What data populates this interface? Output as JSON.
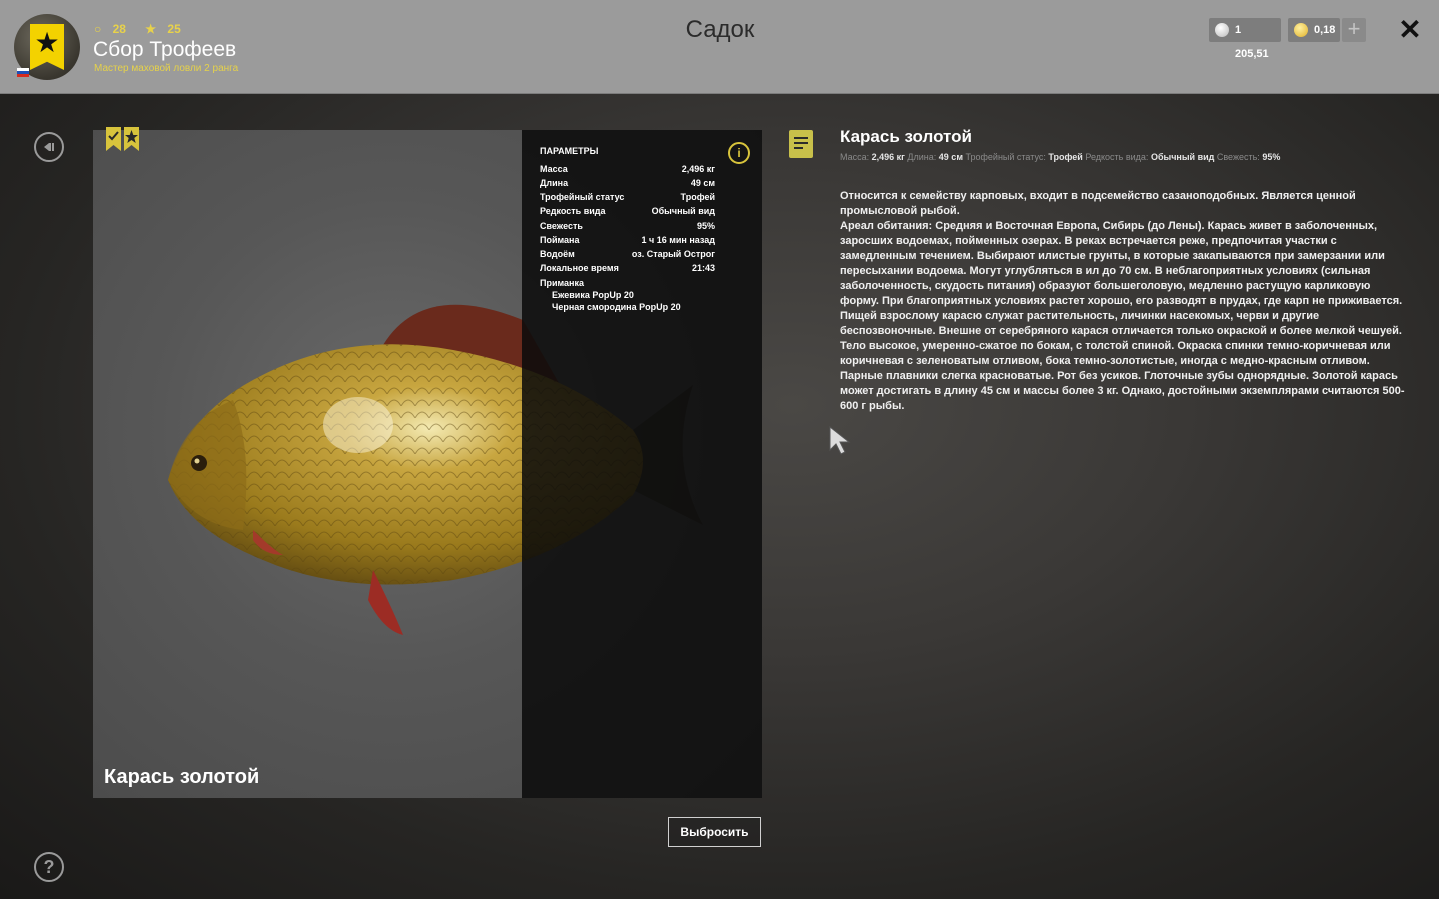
{
  "header": {
    "title": "Садок",
    "player": {
      "level": "28",
      "rank_stars": "25",
      "name": "Сбор Трофеев",
      "rank_title": "Мастер маховой ловли 2 ранга"
    },
    "currency": {
      "silver": "1 205,51",
      "gold": "0,18"
    },
    "plus_label": "+",
    "close_label": "✕"
  },
  "fish": {
    "caption": "Карась золотой",
    "params_title": "ПАРАМЕТРЫ",
    "params": [
      {
        "k": "Масса",
        "v": "2,496 кг"
      },
      {
        "k": "Длина",
        "v": "49 см"
      },
      {
        "k": "Трофейный статус",
        "v": "Трофей"
      },
      {
        "k": "Редкость вида",
        "v": "Обычный вид"
      },
      {
        "k": "Свежесть",
        "v": "95%"
      },
      {
        "k": "Поймана",
        "v": "1 ч 16 мин назад"
      },
      {
        "k": "Водоём",
        "v": "оз. Старый Острог"
      },
      {
        "k": "Локальное время",
        "v": "21:43"
      }
    ],
    "bait_label": "Приманка",
    "baits": [
      "Ежевика PopUp 20",
      "Черная смородина PopUp 20"
    ],
    "info_label": "i"
  },
  "discard_label": "Выбросить",
  "description": {
    "title": "Карась золотой",
    "meta": [
      {
        "k": "Масса:",
        "v": "2,496 кг"
      },
      {
        "k": "Длина:",
        "v": "49 см"
      },
      {
        "k": "Трофейный статус:",
        "v": "Трофей"
      },
      {
        "k": "Редкость вида:",
        "v": "Обычный вид"
      },
      {
        "k": "Свежесть:",
        "v": "95%"
      }
    ],
    "paragraphs": [
      "Относится к семейству карповых, входит в подсемейство сазаноподобных. Является ценной промысловой рыбой.",
      "Ареал обитания: Средняя и Восточная Европа, Сибирь (до Лены). Карась живет в заболоченных, заросших водоемах, пойменных озерах. В реках встречается реже, предпочитая участки с замедленным течением. Выбирают илистые грунты, в которые закапываются при замерзании или пересыхании водоема. Могут углубляться в ил до 70 см. В неблагоприятных условиях (сильная заболоченность, скудость питания) образуют большеголовую, медленно растущую карликовую форму. При благоприятных условиях растет хорошо, его разводят в прудах, где карп не приживается. Пищей взрослому карасю служат растительность, личинки насекомых, черви и другие беспозвоночные. Внешне от серебряного карася отличается только окраской и более мелкой чешуей. Тело высокое, умеренно-сжатое по бокам, с толстой спиной. Окраска спинки темно-коричневая или коричневая с зеленоватым отливом, бока темно-золотистые, иногда с медно-красным отливом. Парные плавники слегка красноватые. Рот без усиков. Глоточные зубы однорядные. Золотой карась может достигать в длину 45 см и массы более 3 кг. Однако, достойными экземплярами считаются 500-600 г рыбы."
    ]
  },
  "icons": {
    "back": "back-icon",
    "help": "?",
    "note": "note-icon",
    "bookmarks": "trophy-bookmark-icons"
  },
  "colors": {
    "accent_yellow": "#d8c43c",
    "header_bg": "#9b9b9b"
  }
}
